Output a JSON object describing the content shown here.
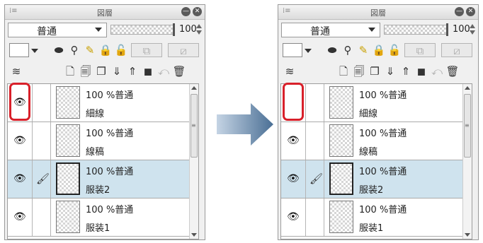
{
  "arrow_color": "#4a6f95",
  "highlight_color": "#d8202a",
  "panels": {
    "before": {
      "title": "図層",
      "blend_mode": "普通",
      "opacity": "100",
      "layers": [
        {
          "status": "100 %普通",
          "name": "細線",
          "visible": true
        },
        {
          "status": "100 %普通",
          "name": "線稿",
          "visible": true
        },
        {
          "status": "100 %普通",
          "name": "服装2",
          "visible": true
        },
        {
          "status": "100 %普通",
          "name": "服装1",
          "visible": true
        }
      ]
    },
    "after": {
      "title": "図層",
      "blend_mode": "普通",
      "opacity": "100",
      "layers": [
        {
          "status": "100 %普通",
          "name": "細線",
          "visible": false
        },
        {
          "status": "100 %普通",
          "name": "線稿",
          "visible": true
        },
        {
          "status": "100 %普通",
          "name": "服装2",
          "visible": true
        },
        {
          "status": "100 %普通",
          "name": "服装1",
          "visible": true
        }
      ]
    }
  },
  "icons": {
    "eye": "eye-icon",
    "brush": "brush-icon"
  }
}
